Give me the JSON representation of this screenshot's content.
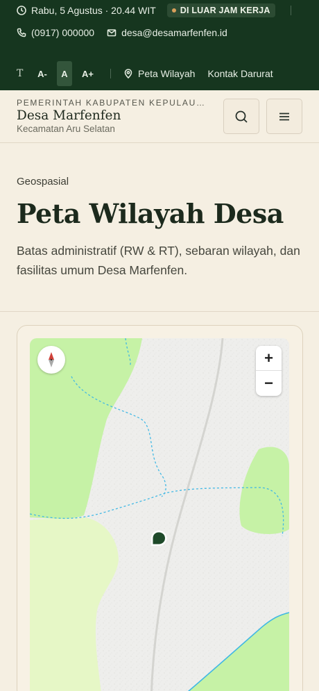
{
  "topbar": {
    "datetime": "Rabu, 5 Agustus · 20.44 WIT",
    "status_badge": "DI LUAR JAM KERJA",
    "phone": "(0917) 000000",
    "email": "desa@desamarfenfen.id",
    "font_size_icon_label": "T",
    "font_decrease": "A-",
    "font_normal": "A",
    "font_increase": "A+",
    "links": [
      {
        "label": "Peta Wilayah",
        "icon": "map-pin-icon"
      },
      {
        "label": "Kontak Darurat",
        "icon": ""
      }
    ]
  },
  "header": {
    "government": "PEMERINTAH KABUPATEN KEPULAUAN ARU",
    "village_name": "Desa Marfenfen",
    "district": "Kecamatan Aru Selatan",
    "search_icon": "search-icon",
    "menu_icon": "menu-icon"
  },
  "hero": {
    "eyebrow": "Geospasial",
    "title": "Peta Wilayah Desa",
    "description": "Batas administratif (RW & RT), sebaran wilayah, dan fasilitas umum Desa Marfenfen."
  },
  "map": {
    "zoom_in_label": "+",
    "zoom_out_label": "−",
    "compass_icon": "compass-icon",
    "marker_icon": "location-marker-icon",
    "colors": {
      "forest": "#c6f2a6",
      "light_green": "#e6f7c6",
      "ground": "#eeeeec",
      "water": "#41b8e4",
      "marker": "#1f4a2a",
      "topbar": "#16361f"
    }
  }
}
